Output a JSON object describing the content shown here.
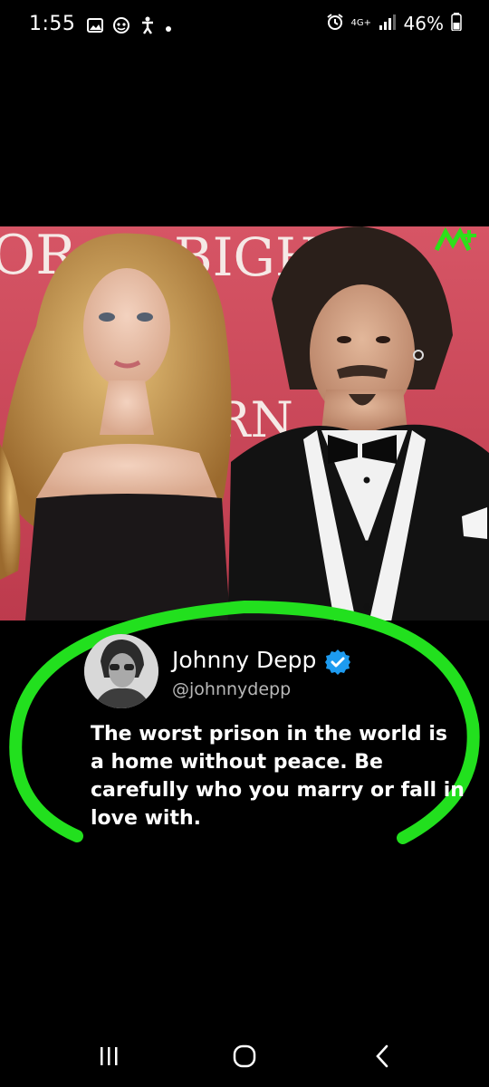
{
  "status_bar": {
    "time": "1:55",
    "network": "4G+",
    "battery": "46%",
    "icons": [
      "gallery-icon",
      "messenger-icon",
      "accessibility-icon",
      "dot-icon",
      "alarm-icon",
      "signal-icon",
      "battery-icon"
    ]
  },
  "post": {
    "backdrop_text_left": "OR",
    "backdrop_text_center": "BIGH",
    "backdrop_text_lower": "RN",
    "watermark": "logo-icon"
  },
  "tweet": {
    "name": "Johnny Depp",
    "handle": "@johnnydepp",
    "text": "The worst prison in the world is a home without peace. Be carefully who you marry or fall in love with.",
    "ring_color": "#22e01e",
    "verified_color": "#1d9bf0"
  },
  "nav": {
    "recents": "recents-icon",
    "home": "home-icon",
    "back": "back-icon"
  }
}
